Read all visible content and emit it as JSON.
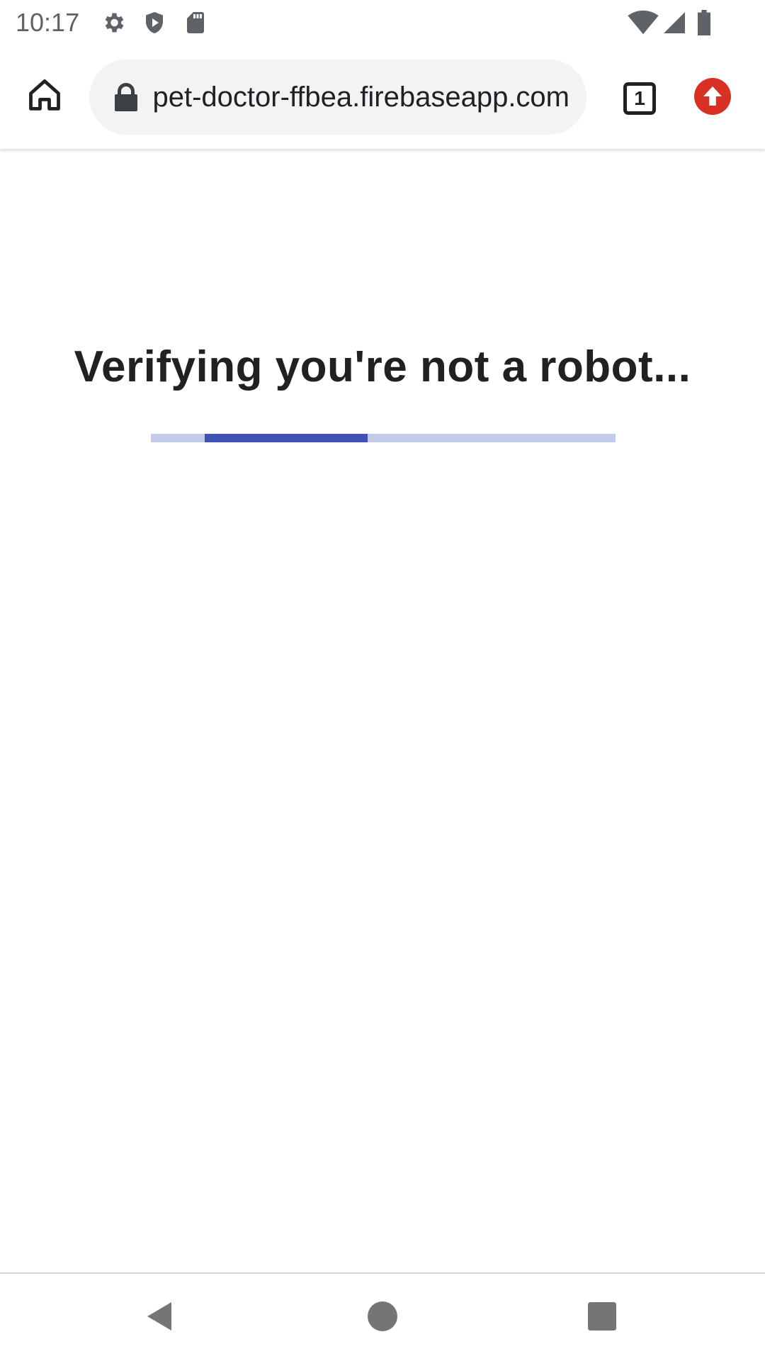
{
  "status_bar": {
    "time": "10:17",
    "left_icons": [
      "settings-icon",
      "shield-play-icon",
      "sd-card-icon"
    ],
    "right_icons": [
      "wifi-icon",
      "cell-signal-icon",
      "battery-icon"
    ]
  },
  "browser": {
    "url_display": "pet-doctor-ffbea.firebaseapp.com",
    "tab_count": "1",
    "icons": {
      "home": "home-icon",
      "lock": "lock-icon",
      "tabs": "tab-switcher-icon",
      "update": "update-available-icon"
    },
    "update_color": "#d93025"
  },
  "page": {
    "heading": "Verifying you're not a robot...",
    "progress": {
      "indeterminate": true,
      "visible_fill_fraction": 0.35,
      "track_color": "#c5cae9",
      "bar_color": "#3f51b5"
    }
  },
  "nav_bar": {
    "buttons": [
      "back-icon",
      "home-circle-icon",
      "recents-icon"
    ]
  }
}
